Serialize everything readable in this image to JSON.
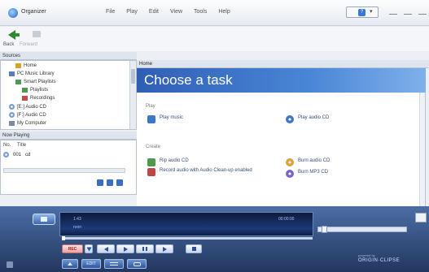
{
  "window": {
    "app_title": "Organizer",
    "menu": [
      "File",
      "Play",
      "Edit",
      "View",
      "Tools",
      "Help"
    ],
    "help_glyph": "?",
    "help_dropdown_glyph": "▾"
  },
  "nav": {
    "back_label": "Back",
    "forward_label": "Forward"
  },
  "sources": {
    "header": "Sources",
    "items": [
      {
        "label": "Home",
        "icon": "home-icon"
      },
      {
        "label": "PC Music Library",
        "icon": "library-icon"
      },
      {
        "label": "Smart Playlists",
        "icon": "playlist-icon"
      },
      {
        "label": "Playlists",
        "icon": "playlist-icon"
      },
      {
        "label": "Recordings",
        "icon": "recording-icon"
      },
      {
        "label": "[E:] Audio CD",
        "icon": "cd-icon"
      },
      {
        "label": "[F:] Audio CD",
        "icon": "cd-icon"
      },
      {
        "label": "My Computer",
        "icon": "computer-icon"
      }
    ]
  },
  "now_playing": {
    "header": "Now Playing",
    "columns": [
      "No.",
      "Title"
    ],
    "rows": [
      {
        "no": "001",
        "title": "cd"
      }
    ]
  },
  "main": {
    "header": "Home",
    "banner_title": "Choose a task",
    "sections": [
      {
        "label": "Play",
        "tasks": [
          {
            "label": "Play music",
            "icon": "music-icon"
          },
          {
            "label": "Play audio CD",
            "icon": "audio-cd-icon"
          }
        ]
      },
      {
        "label": "Create",
        "tasks": [
          {
            "label": "Rip audio CD",
            "icon": "rip-icon"
          },
          {
            "label": "Record audio with Audio Clean-up enabled",
            "icon": "record-icon"
          },
          {
            "label": "Burn audio CD",
            "icon": "burn-cd-icon"
          },
          {
            "label": "Burn MP3 CD",
            "icon": "burn-mp3-icon"
          }
        ]
      }
    ]
  },
  "player": {
    "lcd_line1": "1:43",
    "lcd_line2": "roon",
    "lcd_time": "00:00:00",
    "record_label": "REC",
    "edit_label": "EDIT",
    "brand_small": "powered by",
    "brand": "ORIGIN·CLIPSE"
  },
  "colors": {
    "banner": "#3d72c6",
    "player": "#2f4a7e",
    "accent": "#3a77d0"
  }
}
